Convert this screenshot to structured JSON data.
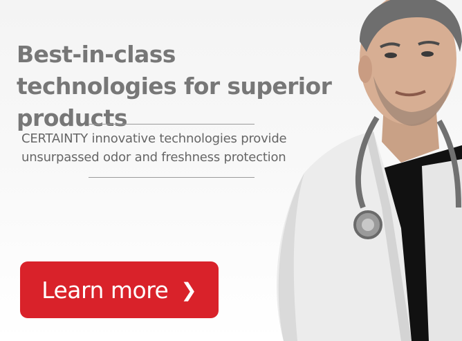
{
  "banner": {
    "headline": "Best-in-class technologies for superior products",
    "subtext": "CERTAINTY innovative technologies provide unsurpassed odor and freshness protection",
    "cta": {
      "label": "Learn more",
      "chevron": "❯",
      "color": "#d9222a"
    },
    "photo_icon": "doctor-portrait-icon"
  }
}
